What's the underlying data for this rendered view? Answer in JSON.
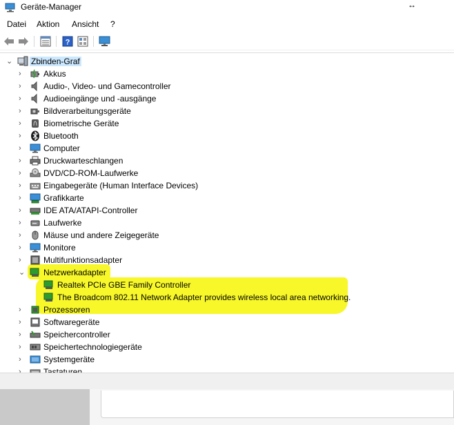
{
  "window": {
    "title": "Geräte-Manager"
  },
  "menu": [
    "Datei",
    "Aktion",
    "Ansicht",
    "?"
  ],
  "tree": {
    "root": "Zbinden-Graf",
    "categories": [
      {
        "label": "Akkus",
        "icon": "battery-icon"
      },
      {
        "label": "Audio-, Video- und Gamecontroller",
        "icon": "speaker-icon"
      },
      {
        "label": "Audioeingänge und -ausgänge",
        "icon": "speaker-icon"
      },
      {
        "label": "Bildverarbeitungsgeräte",
        "icon": "camera-icon"
      },
      {
        "label": "Biometrische Geräte",
        "icon": "fingerprint-icon"
      },
      {
        "label": "Bluetooth",
        "icon": "bluetooth-icon"
      },
      {
        "label": "Computer",
        "icon": "monitor-icon"
      },
      {
        "label": "Druckwarteschlangen",
        "icon": "printer-icon"
      },
      {
        "label": "DVD/CD-ROM-Laufwerke",
        "icon": "dvd-drive-icon"
      },
      {
        "label": "Eingabegeräte (Human Interface Devices)",
        "icon": "hid-icon"
      },
      {
        "label": "Grafikkarte",
        "icon": "display-adapter-icon"
      },
      {
        "label": "IDE ATA/ATAPI-Controller",
        "icon": "ide-controller-icon"
      },
      {
        "label": "Laufwerke",
        "icon": "disk-drive-icon"
      },
      {
        "label": "Mäuse und andere Zeigegeräte",
        "icon": "mouse-icon"
      },
      {
        "label": "Monitore",
        "icon": "monitor-icon"
      },
      {
        "label": "Multifunktionsadapter",
        "icon": "multifunction-icon"
      },
      {
        "label": "Netzwerkadapter",
        "icon": "network-adapter-icon",
        "expanded": true,
        "children": [
          {
            "label": "Realtek PCIe GBE Family Controller",
            "icon": "network-adapter-icon"
          },
          {
            "label": "The Broadcom 802.11 Network Adapter provides wireless local area networking.",
            "icon": "network-adapter-icon"
          }
        ]
      },
      {
        "label": "Prozessoren",
        "icon": "processor-icon"
      },
      {
        "label": "Softwaregeräte",
        "icon": "software-device-icon"
      },
      {
        "label": "Speichercontroller",
        "icon": "storage-controller-icon"
      },
      {
        "label": "Speichertechnologiegeräte",
        "icon": "memory-tech-icon"
      },
      {
        "label": "Systemgeräte",
        "icon": "system-device-icon"
      },
      {
        "label": "Tastaturen",
        "icon": "keyboard-icon"
      }
    ]
  },
  "colors": {
    "highlight": "#f7f72a",
    "selection": "#cce8ff",
    "network_green": "#2e9b2e"
  }
}
